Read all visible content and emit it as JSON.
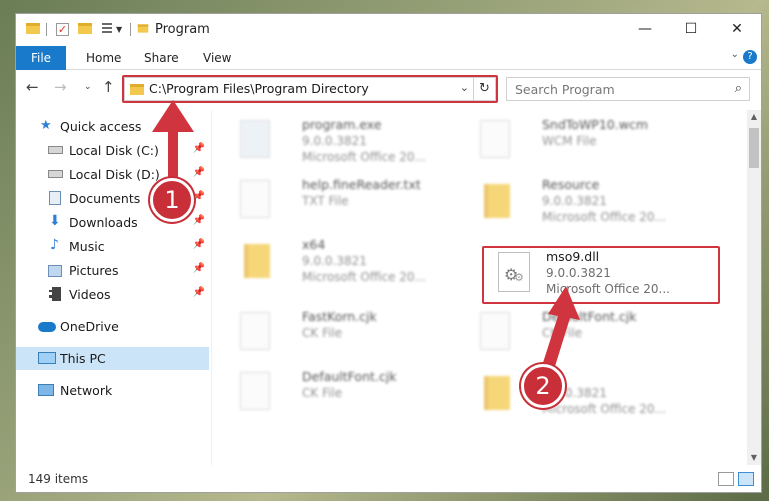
{
  "window": {
    "title": "Program",
    "minimize": "—",
    "maximize": "☐",
    "close": "✕"
  },
  "ribbon": {
    "tabs": [
      "File",
      "Home",
      "Share",
      "View"
    ],
    "expand": "⌄",
    "help": "?"
  },
  "address": {
    "path": "C:\\Program Files\\Program Directory",
    "search_placeholder": "Search Program"
  },
  "nav": {
    "items": [
      {
        "label": "Quick access",
        "icon": "star-icon"
      },
      {
        "label": "Local Disk (C:)",
        "icon": "drive-icon"
      },
      {
        "label": "Local Disk (D:)",
        "icon": "drive-icon"
      },
      {
        "label": "Documents",
        "icon": "documents-icon"
      },
      {
        "label": "Downloads",
        "icon": "download-icon"
      },
      {
        "label": "Music",
        "icon": "music-icon"
      },
      {
        "label": "Pictures",
        "icon": "pictures-icon"
      },
      {
        "label": "Videos",
        "icon": "videos-icon"
      },
      {
        "label": "OneDrive",
        "icon": "cloud-icon"
      },
      {
        "label": "This PC",
        "icon": "computer-icon"
      },
      {
        "label": "Network",
        "icon": "network-icon"
      }
    ]
  },
  "files": [
    {
      "name": "program.exe",
      "line2": "9.0.0.3821",
      "line3": "Microsoft Office 20...",
      "kind": "exe"
    },
    {
      "name": "SndToWP10.wcm",
      "line2": "WCM File",
      "line3": "",
      "kind": "file"
    },
    {
      "name": "help.fineReader.txt",
      "line2": "TXT File",
      "line3": "",
      "kind": "file"
    },
    {
      "name": "Resource",
      "line2": "9.0.0.3821",
      "line3": "Microsoft Office 20...",
      "kind": "folder"
    },
    {
      "name": "x64",
      "line2": "9.0.0.3821",
      "line3": "Microsoft Office 20...",
      "kind": "folder"
    },
    {
      "name": "mso9.dll",
      "line2": "9.0.0.3821",
      "line3": "Microsoft Office 20...",
      "kind": "dll"
    },
    {
      "name": "FastKorn.cjk",
      "line2": "CK File",
      "line3": "",
      "kind": "file"
    },
    {
      "name": "DefaultFont.cjk",
      "line2": "CK File",
      "line3": "",
      "kind": "file"
    },
    {
      "name": "DefaultFont.cjk",
      "line2": "CK File",
      "line3": "",
      "kind": "file"
    },
    {
      "name": "",
      "line2": "9.0.0.3821",
      "line3": "Microsoft Office 20...",
      "kind": "folder"
    }
  ],
  "status": {
    "count": "149 items"
  },
  "annotations": {
    "step1": "1",
    "step2": "2",
    "highlight_color": "#d0353f"
  }
}
